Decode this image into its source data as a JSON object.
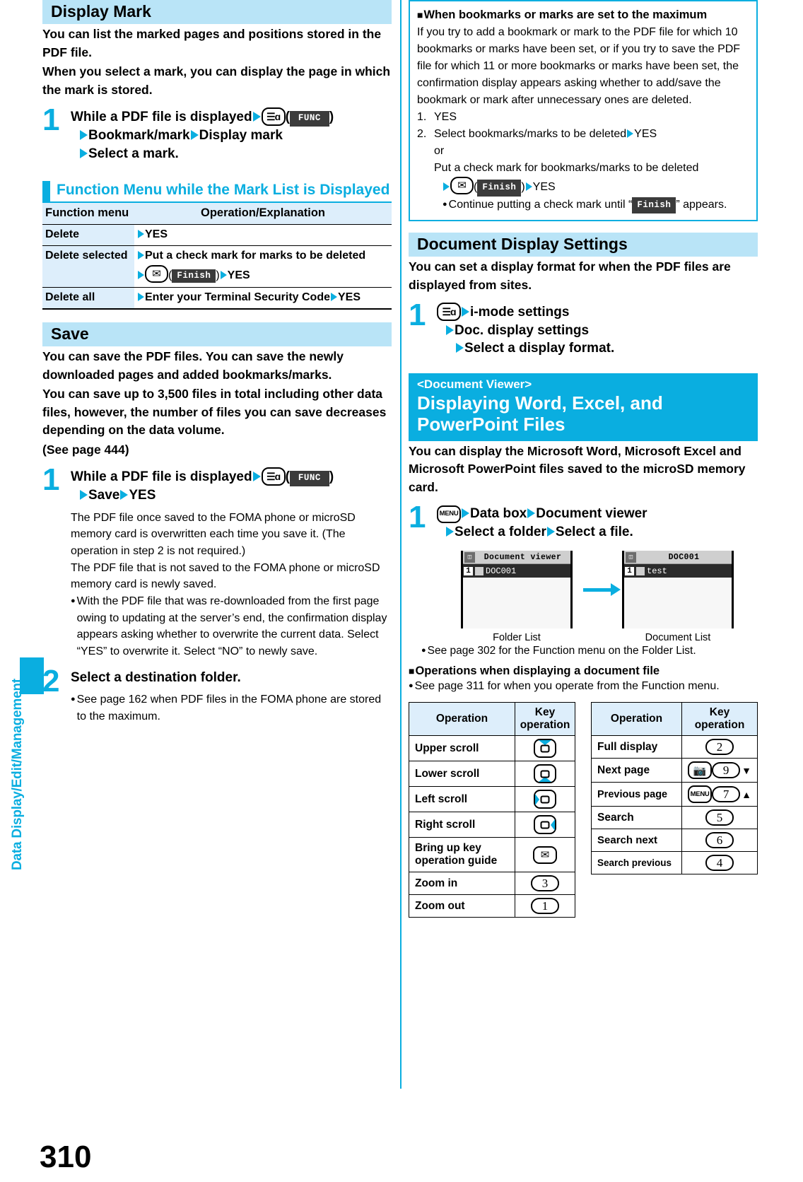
{
  "page": {
    "number": "310",
    "side_label": "Data Display/Edit/Management",
    "accent": "#0aaee0",
    "band": "#b9e4f7",
    "table_header_fill": "#ddeefb"
  },
  "left": {
    "display_mark": {
      "heading": "Display Mark",
      "intro_lines": [
        "You can list the marked pages and positions stored in the PDF file.",
        "When you select a mark, you can display the page in which the mark is stored."
      ],
      "step": {
        "num": "1",
        "lead_pre": "While a PDF file is displayed",
        "key_icon": "i-mode-func-key-icon",
        "softkey": "FUNC",
        "line2_a": "Bookmark/mark",
        "line2_b": "Display mark",
        "line3": "Select a mark."
      }
    },
    "function_menu": {
      "heading": "Function Menu while the Mark List is Displayed",
      "columns": [
        "Function menu",
        "Operation/Explanation"
      ],
      "rows": [
        {
          "menu": "Delete",
          "op_lines": [
            "YES"
          ]
        },
        {
          "menu": "Delete selected",
          "op_lines": [
            "Put a check mark for marks to be deleted",
            "( Finish ) YES"
          ]
        },
        {
          "menu": "Delete all",
          "op_lines": [
            "Enter your Terminal Security Code YES"
          ]
        }
      ],
      "row2_line1": "Put a check mark for marks to be deleted",
      "row2_softkey": "Finish",
      "row2_yes": "YES",
      "row3_text": "Enter your Terminal Security Code",
      "row3_yes": "YES",
      "row1_yes": "YES"
    },
    "save": {
      "heading": "Save",
      "intro_lines": [
        "You can save the PDF files. You can save the newly downloaded pages and added bookmarks/marks.",
        "You can save up to 3,500 files in total including other data files, however, the number of files you can save decreases depending on the data volume.",
        "(See page 444)"
      ],
      "step1": {
        "num": "1",
        "lead_pre": "While a PDF file is displayed",
        "key_icon": "i-mode-func-key-icon",
        "softkey": "FUNC",
        "line2_a": "Save",
        "line2_b": "YES",
        "notes": [
          "The PDF file once saved to the FOMA phone or microSD memory card is overwritten each time you save it. (The operation in step 2 is not required.)",
          "The PDF file that is not saved to the FOMA phone or microSD memory card is newly saved.",
          "With the PDF file that was re-downloaded from the first page owing to updating at the server’s end, the confirmation display appears asking whether to overwrite the current data. Select “YES” to overwrite it. Select “NO” to newly save."
        ]
      },
      "step2": {
        "num": "2",
        "lead": "Select a destination folder.",
        "note": "See page 162 when PDF files in the FOMA phone are stored to the maximum."
      }
    }
  },
  "right": {
    "callout": {
      "title": "When bookmarks or marks are set to the maximum",
      "body": "If you try to add a bookmark or mark to the PDF file for which 10 bookmarks or marks have been set, or if you try to save the PDF file for which 11 or more bookmarks or marks have been set, the confirmation display appears asking whether to add/save the bookmark or mark after unnecessary ones are deleted.",
      "item1_num": "1.",
      "item1_text": "YES",
      "item2_num": "2.",
      "item2_text": "Select bookmarks/marks to be deleted",
      "item2_yes": "YES",
      "or": "or",
      "item2_alt": "Put a check mark for bookmarks/marks to be deleted",
      "item2_softkey": "Finish",
      "item2_alt_yes": "YES",
      "bullet_pre": "Continue putting a check mark until “",
      "bullet_softkey": "Finish",
      "bullet_post": "” appears."
    },
    "doc_display_settings": {
      "heading": "Document Display Settings",
      "intro": "You can set a display format for when the PDF files are displayed from sites.",
      "step": {
        "num": "1",
        "key_icon": "i-mode-func-key-icon",
        "line1": "i-mode settings",
        "line2": "Doc. display settings",
        "line3": "Select a display format."
      }
    },
    "document_viewer": {
      "kicker": "<Document Viewer>",
      "title": "Displaying Word, Excel, and PowerPoint Files",
      "intro": "You can display the Microsoft Word, Microsoft Excel and Microsoft PowerPoint files saved to the microSD memory card.",
      "step": {
        "num": "1",
        "key_icon": "menu-key-icon",
        "line1_a": "Data box",
        "line1_b": "Document viewer",
        "line2_a": "Select a folder",
        "line2_b": "Select a file."
      },
      "screens": [
        {
          "title": "Document viewer",
          "item_index": "1",
          "item_label": "DOC001",
          "caption": "Folder List"
        },
        {
          "title": "DOC001",
          "item_index": "1",
          "item_label": "test",
          "caption": "Document List"
        }
      ],
      "see_note": "See page 302 for the Function menu on the Folder List.",
      "sub_heading": "Operations when displaying a document file",
      "sub_note": "See page 311 for when you operate from the Function menu."
    },
    "op_table_left": {
      "columns": [
        "Operation",
        "Key operation"
      ],
      "rows": [
        {
          "label": "Upper scroll",
          "key": "nav-up"
        },
        {
          "label": "Lower scroll",
          "key": "nav-down"
        },
        {
          "label": "Left scroll",
          "key": "nav-left"
        },
        {
          "label": "Right scroll",
          "key": "nav-right"
        },
        {
          "label": "Bring up key operation guide",
          "key": "mail-key"
        },
        {
          "label": "Zoom in",
          "key": "3"
        },
        {
          "label": "Zoom out",
          "key": "1"
        }
      ]
    },
    "op_table_right": {
      "columns": [
        "Operation",
        "Key operation"
      ],
      "rows": [
        {
          "label": "Full display",
          "keys": [
            "2"
          ]
        },
        {
          "label": "Next page",
          "keys": [
            "camera-key",
            "9",
            "down-triangle"
          ]
        },
        {
          "label": "Previous page",
          "keys": [
            "menu-key",
            "7",
            "up-triangle"
          ]
        },
        {
          "label": "Search",
          "keys": [
            "5"
          ]
        },
        {
          "label": "Search next",
          "keys": [
            "6"
          ]
        },
        {
          "label": "Search previous",
          "keys": [
            "4"
          ]
        }
      ]
    }
  }
}
